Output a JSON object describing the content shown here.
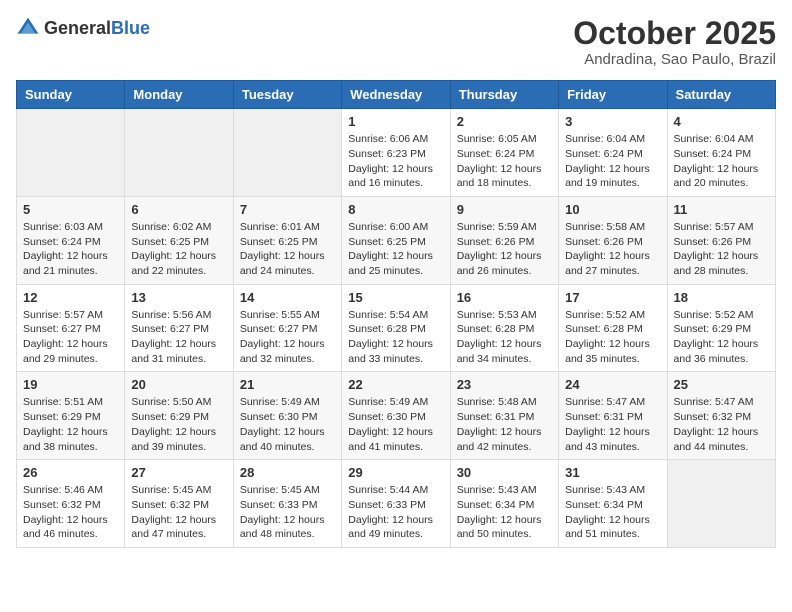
{
  "header": {
    "logo_general": "General",
    "logo_blue": "Blue",
    "month_title": "October 2025",
    "subtitle": "Andradina, Sao Paulo, Brazil"
  },
  "days_of_week": [
    "Sunday",
    "Monday",
    "Tuesday",
    "Wednesday",
    "Thursday",
    "Friday",
    "Saturday"
  ],
  "weeks": [
    [
      {
        "day": "",
        "info": ""
      },
      {
        "day": "",
        "info": ""
      },
      {
        "day": "",
        "info": ""
      },
      {
        "day": "1",
        "info": "Sunrise: 6:06 AM\nSunset: 6:23 PM\nDaylight: 12 hours\nand 16 minutes."
      },
      {
        "day": "2",
        "info": "Sunrise: 6:05 AM\nSunset: 6:24 PM\nDaylight: 12 hours\nand 18 minutes."
      },
      {
        "day": "3",
        "info": "Sunrise: 6:04 AM\nSunset: 6:24 PM\nDaylight: 12 hours\nand 19 minutes."
      },
      {
        "day": "4",
        "info": "Sunrise: 6:04 AM\nSunset: 6:24 PM\nDaylight: 12 hours\nand 20 minutes."
      }
    ],
    [
      {
        "day": "5",
        "info": "Sunrise: 6:03 AM\nSunset: 6:24 PM\nDaylight: 12 hours\nand 21 minutes."
      },
      {
        "day": "6",
        "info": "Sunrise: 6:02 AM\nSunset: 6:25 PM\nDaylight: 12 hours\nand 22 minutes."
      },
      {
        "day": "7",
        "info": "Sunrise: 6:01 AM\nSunset: 6:25 PM\nDaylight: 12 hours\nand 24 minutes."
      },
      {
        "day": "8",
        "info": "Sunrise: 6:00 AM\nSunset: 6:25 PM\nDaylight: 12 hours\nand 25 minutes."
      },
      {
        "day": "9",
        "info": "Sunrise: 5:59 AM\nSunset: 6:26 PM\nDaylight: 12 hours\nand 26 minutes."
      },
      {
        "day": "10",
        "info": "Sunrise: 5:58 AM\nSunset: 6:26 PM\nDaylight: 12 hours\nand 27 minutes."
      },
      {
        "day": "11",
        "info": "Sunrise: 5:57 AM\nSunset: 6:26 PM\nDaylight: 12 hours\nand 28 minutes."
      }
    ],
    [
      {
        "day": "12",
        "info": "Sunrise: 5:57 AM\nSunset: 6:27 PM\nDaylight: 12 hours\nand 29 minutes."
      },
      {
        "day": "13",
        "info": "Sunrise: 5:56 AM\nSunset: 6:27 PM\nDaylight: 12 hours\nand 31 minutes."
      },
      {
        "day": "14",
        "info": "Sunrise: 5:55 AM\nSunset: 6:27 PM\nDaylight: 12 hours\nand 32 minutes."
      },
      {
        "day": "15",
        "info": "Sunrise: 5:54 AM\nSunset: 6:28 PM\nDaylight: 12 hours\nand 33 minutes."
      },
      {
        "day": "16",
        "info": "Sunrise: 5:53 AM\nSunset: 6:28 PM\nDaylight: 12 hours\nand 34 minutes."
      },
      {
        "day": "17",
        "info": "Sunrise: 5:52 AM\nSunset: 6:28 PM\nDaylight: 12 hours\nand 35 minutes."
      },
      {
        "day": "18",
        "info": "Sunrise: 5:52 AM\nSunset: 6:29 PM\nDaylight: 12 hours\nand 36 minutes."
      }
    ],
    [
      {
        "day": "19",
        "info": "Sunrise: 5:51 AM\nSunset: 6:29 PM\nDaylight: 12 hours\nand 38 minutes."
      },
      {
        "day": "20",
        "info": "Sunrise: 5:50 AM\nSunset: 6:29 PM\nDaylight: 12 hours\nand 39 minutes."
      },
      {
        "day": "21",
        "info": "Sunrise: 5:49 AM\nSunset: 6:30 PM\nDaylight: 12 hours\nand 40 minutes."
      },
      {
        "day": "22",
        "info": "Sunrise: 5:49 AM\nSunset: 6:30 PM\nDaylight: 12 hours\nand 41 minutes."
      },
      {
        "day": "23",
        "info": "Sunrise: 5:48 AM\nSunset: 6:31 PM\nDaylight: 12 hours\nand 42 minutes."
      },
      {
        "day": "24",
        "info": "Sunrise: 5:47 AM\nSunset: 6:31 PM\nDaylight: 12 hours\nand 43 minutes."
      },
      {
        "day": "25",
        "info": "Sunrise: 5:47 AM\nSunset: 6:32 PM\nDaylight: 12 hours\nand 44 minutes."
      }
    ],
    [
      {
        "day": "26",
        "info": "Sunrise: 5:46 AM\nSunset: 6:32 PM\nDaylight: 12 hours\nand 46 minutes."
      },
      {
        "day": "27",
        "info": "Sunrise: 5:45 AM\nSunset: 6:32 PM\nDaylight: 12 hours\nand 47 minutes."
      },
      {
        "day": "28",
        "info": "Sunrise: 5:45 AM\nSunset: 6:33 PM\nDaylight: 12 hours\nand 48 minutes."
      },
      {
        "day": "29",
        "info": "Sunrise: 5:44 AM\nSunset: 6:33 PM\nDaylight: 12 hours\nand 49 minutes."
      },
      {
        "day": "30",
        "info": "Sunrise: 5:43 AM\nSunset: 6:34 PM\nDaylight: 12 hours\nand 50 minutes."
      },
      {
        "day": "31",
        "info": "Sunrise: 5:43 AM\nSunset: 6:34 PM\nDaylight: 12 hours\nand 51 minutes."
      },
      {
        "day": "",
        "info": ""
      }
    ]
  ]
}
